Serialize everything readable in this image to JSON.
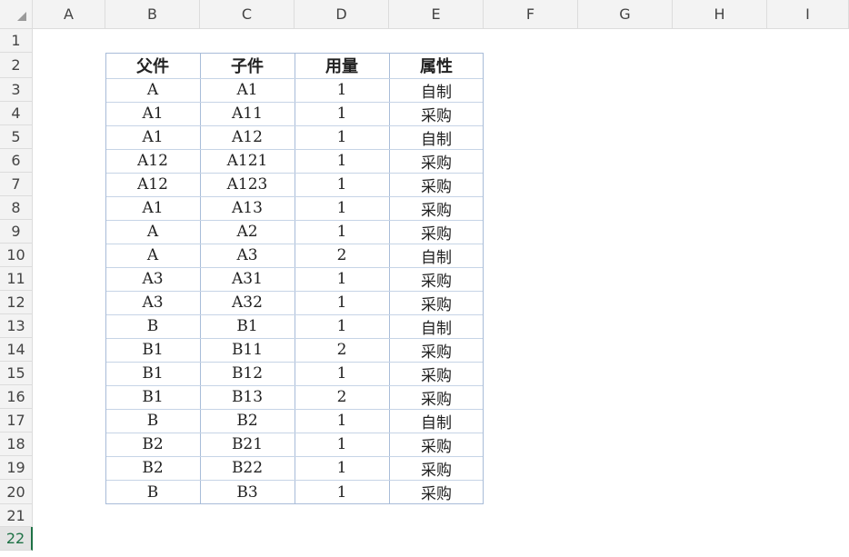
{
  "columns": [
    "A",
    "B",
    "C",
    "D",
    "E",
    "F",
    "G",
    "H",
    "I"
  ],
  "rows": [
    "1",
    "2",
    "3",
    "4",
    "5",
    "6",
    "7",
    "8",
    "9",
    "10",
    "11",
    "12",
    "13",
    "14",
    "15",
    "16",
    "17",
    "18",
    "19",
    "20",
    "21",
    "22"
  ],
  "active_row": "22",
  "table": {
    "headers": [
      "父件",
      "子件",
      "用量",
      "属性"
    ],
    "rows": [
      [
        "A",
        "A1",
        "1",
        "自制"
      ],
      [
        "A1",
        "A11",
        "1",
        "采购"
      ],
      [
        "A1",
        "A12",
        "1",
        "自制"
      ],
      [
        "A12",
        "A121",
        "1",
        "采购"
      ],
      [
        "A12",
        "A123",
        "1",
        "采购"
      ],
      [
        "A1",
        "A13",
        "1",
        "采购"
      ],
      [
        "A",
        "A2",
        "1",
        "采购"
      ],
      [
        "A",
        "A3",
        "2",
        "自制"
      ],
      [
        "A3",
        "A31",
        "1",
        "采购"
      ],
      [
        "A3",
        "A32",
        "1",
        "采购"
      ],
      [
        "B",
        "B1",
        "1",
        "自制"
      ],
      [
        "B1",
        "B11",
        "2",
        "采购"
      ],
      [
        "B1",
        "B12",
        "1",
        "采购"
      ],
      [
        "B1",
        "B13",
        "2",
        "采购"
      ],
      [
        "B",
        "B2",
        "1",
        "自制"
      ],
      [
        "B2",
        "B21",
        "1",
        "采购"
      ],
      [
        "B2",
        "B22",
        "1",
        "采购"
      ],
      [
        "B",
        "B3",
        "1",
        "采购"
      ]
    ]
  },
  "colors": {
    "header_bg": "#f3f3f3",
    "grid_border": "#dcdcdc",
    "table_border": "#a8bcd8",
    "active_row": "#1e7145"
  }
}
